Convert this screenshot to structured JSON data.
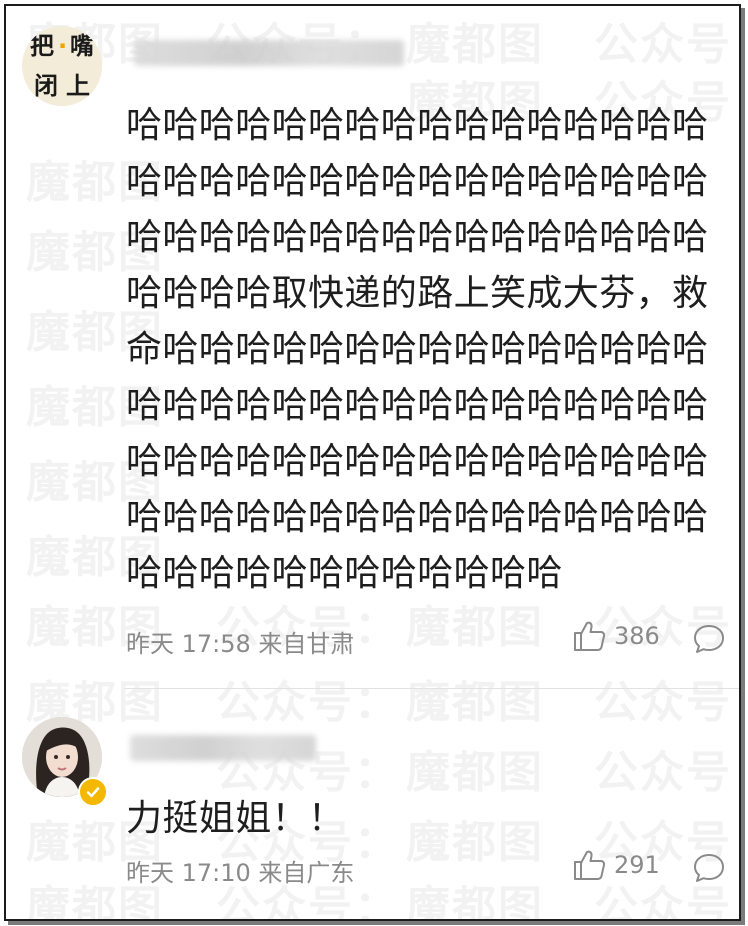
{
  "watermark": {
    "brand": "魔都图",
    "channel": "公众号："
  },
  "comments": [
    {
      "avatar_text": [
        "把",
        "·",
        "嘴",
        "闭",
        "上"
      ],
      "text": "哈哈哈哈哈哈哈哈哈哈哈哈哈哈哈哈哈哈哈哈哈哈哈哈哈哈哈哈哈哈哈哈哈哈哈哈哈哈哈哈哈哈哈哈哈哈哈哈哈哈哈哈取快递的路上笑成大芬，救命哈哈哈哈哈哈哈哈哈哈哈哈哈哈哈哈哈哈哈哈哈哈哈哈哈哈哈哈哈哈哈哈哈哈哈哈哈哈哈哈哈哈哈哈哈哈哈哈哈哈哈哈哈哈哈哈哈哈哈哈哈哈哈哈哈哈哈哈哈哈哈哈哈哈哈",
      "meta": "昨天 17:58 来自甘肃",
      "likes": "386"
    },
    {
      "verified": true,
      "text": "力挺姐姐！！",
      "meta": "昨天 17:10 来自广东",
      "likes": "291"
    }
  ],
  "colors": {
    "text": "#1e1e1e",
    "meta": "#8a8a8a",
    "verified_badge": "#f5b800"
  },
  "icons": {
    "like": "thumbs-up-icon",
    "reply": "comment-bubble-icon",
    "verified": "verified-badge-icon"
  }
}
